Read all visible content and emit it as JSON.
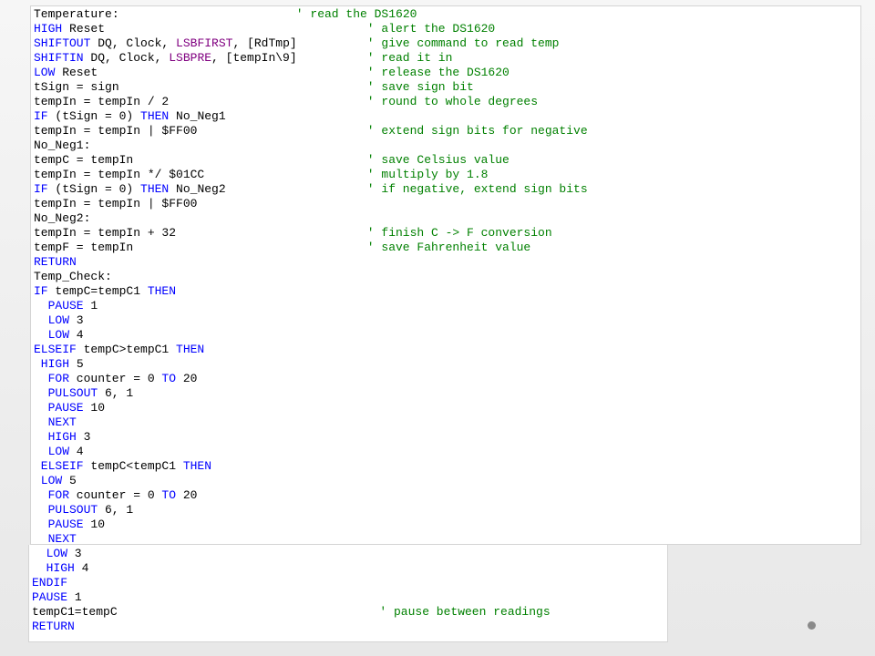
{
  "editor": {
    "language_colors": {
      "keyword": "#0000ff",
      "modifier": "#800080",
      "comment": "#008000",
      "text": "#000000"
    },
    "lines": [
      {
        "indent": "",
        "parts": [
          {
            "t": "Temperature:",
            "c": "text"
          }
        ],
        "comment": "' read the DS1620",
        "commentCol": 36
      },
      {
        "indent": "",
        "parts": [
          {
            "t": "HIGH",
            "c": "keyword"
          },
          {
            "t": " Reset",
            "c": "text"
          }
        ],
        "comment": "' alert the DS1620",
        "commentCol": 46
      },
      {
        "indent": "",
        "parts": [
          {
            "t": "SHIFTOUT",
            "c": "keyword"
          },
          {
            "t": " DQ, Clock, ",
            "c": "text"
          },
          {
            "t": "LSBFIRST",
            "c": "modifier"
          },
          {
            "t": ", [RdTmp]",
            "c": "text"
          }
        ],
        "comment": "' give command to read temp",
        "commentCol": 46
      },
      {
        "indent": "",
        "parts": [
          {
            "t": "SHIFTIN",
            "c": "keyword"
          },
          {
            "t": " DQ, Clock, ",
            "c": "text"
          },
          {
            "t": "LSBPRE",
            "c": "modifier"
          },
          {
            "t": ", [tempIn\\9]",
            "c": "text"
          }
        ],
        "comment": "' read it in",
        "commentCol": 46
      },
      {
        "indent": "",
        "parts": [
          {
            "t": "LOW",
            "c": "keyword"
          },
          {
            "t": " Reset",
            "c": "text"
          }
        ],
        "comment": "' release the DS1620",
        "commentCol": 46
      },
      {
        "indent": "",
        "parts": [
          {
            "t": "tSign = sign",
            "c": "text"
          }
        ],
        "comment": "' save sign bit",
        "commentCol": 46
      },
      {
        "indent": "",
        "parts": [
          {
            "t": "tempIn = tempIn / 2",
            "c": "text"
          }
        ],
        "comment": "' round to whole degrees",
        "commentCol": 46
      },
      {
        "indent": "",
        "parts": [
          {
            "t": "IF",
            "c": "keyword"
          },
          {
            "t": " (tSign = 0) ",
            "c": "text"
          },
          {
            "t": "THEN",
            "c": "keyword"
          },
          {
            "t": " No_Neg1",
            "c": "text"
          }
        ],
        "comment": "",
        "commentCol": 46
      },
      {
        "indent": "",
        "parts": [
          {
            "t": "tempIn = tempIn | $FF00",
            "c": "text"
          }
        ],
        "comment": "' extend sign bits for negative",
        "commentCol": 46
      },
      {
        "indent": "",
        "parts": [
          {
            "t": "No_Neg1:",
            "c": "text"
          }
        ],
        "comment": "",
        "commentCol": 46
      },
      {
        "indent": "",
        "parts": [
          {
            "t": "tempC = tempIn",
            "c": "text"
          }
        ],
        "comment": "' save Celsius value",
        "commentCol": 46
      },
      {
        "indent": "",
        "parts": [
          {
            "t": "tempIn = tempIn */ $01CC",
            "c": "text"
          }
        ],
        "comment": "' multiply by 1.8",
        "commentCol": 46
      },
      {
        "indent": "",
        "parts": [
          {
            "t": "IF",
            "c": "keyword"
          },
          {
            "t": " (tSign = 0) ",
            "c": "text"
          },
          {
            "t": "THEN",
            "c": "keyword"
          },
          {
            "t": " No_Neg2",
            "c": "text"
          }
        ],
        "comment": "' if negative, extend sign bits",
        "commentCol": 46
      },
      {
        "indent": "",
        "parts": [
          {
            "t": "tempIn = tempIn | $FF00",
            "c": "text"
          }
        ],
        "comment": "",
        "commentCol": 46
      },
      {
        "indent": "",
        "parts": [
          {
            "t": "No_Neg2:",
            "c": "text"
          }
        ],
        "comment": "",
        "commentCol": 46
      },
      {
        "indent": "",
        "parts": [
          {
            "t": "tempIn = tempIn + 32",
            "c": "text"
          }
        ],
        "comment": "' finish C -> F conversion",
        "commentCol": 46
      },
      {
        "indent": "",
        "parts": [
          {
            "t": "tempF = tempIn",
            "c": "text"
          }
        ],
        "comment": "' save Fahrenheit value",
        "commentCol": 46
      },
      {
        "indent": "",
        "parts": [
          {
            "t": "RETURN",
            "c": "keyword"
          }
        ],
        "comment": "",
        "commentCol": 46
      },
      {
        "indent": "",
        "parts": [
          {
            "t": "Temp_Check:",
            "c": "text"
          }
        ],
        "comment": "",
        "commentCol": 46
      },
      {
        "indent": "",
        "parts": [
          {
            "t": "IF",
            "c": "keyword"
          },
          {
            "t": " tempC=tempC1 ",
            "c": "text"
          },
          {
            "t": "THEN",
            "c": "keyword"
          }
        ],
        "comment": "",
        "commentCol": 46
      },
      {
        "indent": "  ",
        "parts": [
          {
            "t": "PAUSE",
            "c": "keyword"
          },
          {
            "t": " 1",
            "c": "text"
          }
        ],
        "comment": "",
        "commentCol": 46
      },
      {
        "indent": "  ",
        "parts": [
          {
            "t": "LOW",
            "c": "keyword"
          },
          {
            "t": " 3",
            "c": "text"
          }
        ],
        "comment": "",
        "commentCol": 46
      },
      {
        "indent": "  ",
        "parts": [
          {
            "t": "LOW",
            "c": "keyword"
          },
          {
            "t": " 4",
            "c": "text"
          }
        ],
        "comment": "",
        "commentCol": 46
      },
      {
        "indent": "",
        "parts": [
          {
            "t": "ELSEIF",
            "c": "keyword"
          },
          {
            "t": " tempC>tempC1 ",
            "c": "text"
          },
          {
            "t": "THEN",
            "c": "keyword"
          }
        ],
        "comment": "",
        "commentCol": 46
      },
      {
        "indent": " ",
        "parts": [
          {
            "t": "HIGH",
            "c": "keyword"
          },
          {
            "t": " 5",
            "c": "text"
          }
        ],
        "comment": "",
        "commentCol": 46
      },
      {
        "indent": "  ",
        "parts": [
          {
            "t": "FOR",
            "c": "keyword"
          },
          {
            "t": " counter = 0 ",
            "c": "text"
          },
          {
            "t": "TO",
            "c": "keyword"
          },
          {
            "t": " 20",
            "c": "text"
          }
        ],
        "comment": "",
        "commentCol": 46
      },
      {
        "indent": "  ",
        "parts": [
          {
            "t": "PULSOUT",
            "c": "keyword"
          },
          {
            "t": " 6, 1",
            "c": "text"
          }
        ],
        "comment": "",
        "commentCol": 46
      },
      {
        "indent": "  ",
        "parts": [
          {
            "t": "PAUSE",
            "c": "keyword"
          },
          {
            "t": " 10",
            "c": "text"
          }
        ],
        "comment": "",
        "commentCol": 46
      },
      {
        "indent": "  ",
        "parts": [
          {
            "t": "NEXT",
            "c": "keyword"
          }
        ],
        "comment": "",
        "commentCol": 46
      },
      {
        "indent": "  ",
        "parts": [
          {
            "t": "HIGH",
            "c": "keyword"
          },
          {
            "t": " 3",
            "c": "text"
          }
        ],
        "comment": "",
        "commentCol": 46
      },
      {
        "indent": "  ",
        "parts": [
          {
            "t": "LOW",
            "c": "keyword"
          },
          {
            "t": " 4",
            "c": "text"
          }
        ],
        "comment": "",
        "commentCol": 46
      },
      {
        "indent": " ",
        "parts": [
          {
            "t": "ELSEIF",
            "c": "keyword"
          },
          {
            "t": " tempC<tempC1 ",
            "c": "text"
          },
          {
            "t": "THEN",
            "c": "keyword"
          }
        ],
        "comment": "",
        "commentCol": 46
      },
      {
        "indent": " ",
        "parts": [
          {
            "t": "LOW",
            "c": "keyword"
          },
          {
            "t": " 5",
            "c": "text"
          }
        ],
        "comment": "",
        "commentCol": 46
      },
      {
        "indent": "  ",
        "parts": [
          {
            "t": "FOR",
            "c": "keyword"
          },
          {
            "t": " counter = 0 ",
            "c": "text"
          },
          {
            "t": "TO",
            "c": "keyword"
          },
          {
            "t": " 20",
            "c": "text"
          }
        ],
        "comment": "",
        "commentCol": 46
      },
      {
        "indent": "  ",
        "parts": [
          {
            "t": "PULSOUT",
            "c": "keyword"
          },
          {
            "t": " 6, 1",
            "c": "text"
          }
        ],
        "comment": "",
        "commentCol": 46
      },
      {
        "indent": "  ",
        "parts": [
          {
            "t": "PAUSE",
            "c": "keyword"
          },
          {
            "t": " 10",
            "c": "text"
          }
        ],
        "comment": "",
        "commentCol": 46
      },
      {
        "indent": "  ",
        "parts": [
          {
            "t": "NEXT",
            "c": "keyword"
          }
        ],
        "comment": "",
        "commentCol": 46
      },
      {
        "indent": "  ",
        "parts": [
          {
            "t": "LOW",
            "c": "keyword"
          },
          {
            "t": " 3",
            "c": "text"
          }
        ],
        "comment": "",
        "commentCol": 46
      },
      {
        "indent": "  ",
        "parts": [
          {
            "t": "HIGH",
            "c": "keyword"
          },
          {
            "t": " 4",
            "c": "text"
          }
        ],
        "comment": "",
        "commentCol": 46
      },
      {
        "indent": "",
        "parts": [
          {
            "t": "ENDIF",
            "c": "keyword"
          }
        ],
        "comment": "",
        "commentCol": 46
      },
      {
        "indent": "",
        "parts": [
          {
            "t": "PAUSE",
            "c": "keyword"
          },
          {
            "t": " 1",
            "c": "text"
          }
        ],
        "comment": "",
        "commentCol": 46
      },
      {
        "indent": "",
        "parts": [
          {
            "t": "tempC1=tempC",
            "c": "text"
          }
        ],
        "comment": "' pause between readings",
        "commentCol": 48
      },
      {
        "indent": "",
        "parts": [
          {
            "t": "RETURN",
            "c": "keyword"
          }
        ],
        "comment": "",
        "commentCol": 46
      }
    ]
  },
  "slide": {
    "bullet_icon": "gray-dot-icon"
  }
}
